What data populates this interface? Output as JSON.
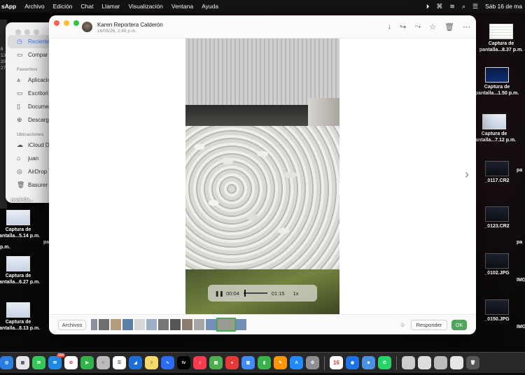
{
  "menubar": {
    "app_name": "sApp",
    "menus": [
      "Archivo",
      "Edición",
      "Chat",
      "Llamar",
      "Visualización",
      "Ventana",
      "Ayuda"
    ],
    "clock": "Sáb 16 de ma"
  },
  "finder": {
    "recientes": "Reciente",
    "compartido": "Compar",
    "favoritos_header": "Favoritos",
    "aplicaciones": "Aplicacio",
    "escritorio": "Escritori",
    "documentos": "Docume",
    "descargas": "Descarg",
    "ubicaciones_header": "Ubicaciones",
    "icloud": "iCloud D",
    "juan": "juan",
    "airdrop": "AirDrop",
    "basura": "Basurer"
  },
  "sliver": {
    "lines": [
      "6",
      "13",
      "20",
      "27"
    ]
  },
  "viewer": {
    "sender_name": "Karen Reportera Calderón",
    "sent_date": "16/05/26, 2:48 p.m.",
    "player": {
      "elapsed": "00:04",
      "duration": "01:15",
      "speed": "1x",
      "progress_fraction": 0.05
    },
    "footer": {
      "archivos": "Archivos",
      "responder": "Responder",
      "ok": "OK"
    }
  },
  "desktop_left": [
    {
      "line1": "pantalla...",
      "line2": ""
    },
    {
      "line1": "Captura de",
      "line2": "pantalla...5.14 p.m."
    },
    {
      "line1": "Captura de",
      "line2": "pantalla...6.27 p.m."
    },
    {
      "line1": "Captura de",
      "line2": "pantalla...8.13 p.m."
    }
  ],
  "desktop_right": [
    {
      "line1": "Captura de",
      "line2": "pantalla...8.37 p.m."
    },
    {
      "line1": "Captura de",
      "line2": "pantalla...1.50 p.m."
    },
    {
      "line1": "Captura de",
      "line2": "pantalla...7.12 p.m."
    },
    {
      "line1": "_0117.CR2",
      "line2": ""
    },
    {
      "line1": "_0123.CR2",
      "line2": ""
    },
    {
      "line1": "_0102.JPG",
      "line2": ""
    },
    {
      "line1": "_0150.JPG",
      "line2": ""
    }
  ],
  "desktop_far_right": [
    "pa",
    "pa",
    "IMG",
    "IMG"
  ],
  "desktop_mid_left": [
    "p.m.",
    "pa"
  ],
  "dock": {
    "mail_badge": "154",
    "calendar_day": "16",
    "tv_label": "tv"
  }
}
